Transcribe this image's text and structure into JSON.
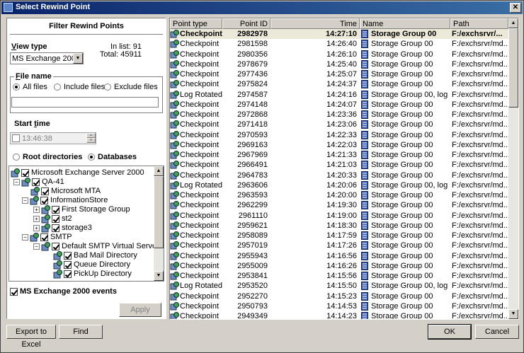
{
  "window": {
    "title": "Select Rewind Point",
    "close_glyph": "✕"
  },
  "filter": {
    "title": "Filter Rewind Points",
    "view_type_label": "View type",
    "view_type_value": "MS Exchange 2000",
    "in_list": "In list: 91",
    "total": "Total: 45911",
    "file_name_label": "File name",
    "radio_all": "All files",
    "radio_include": "Include files",
    "radio_exclude": "Exclude files",
    "file_name_value": "",
    "start_time_label": "Start time",
    "start_time_value": "13:46:38",
    "radio_root": "Root directories",
    "radio_databases": "Databases",
    "tree": [
      "Microsoft Exchange Server 2000",
      "QA-41",
      "Microsoft MTA",
      "InformationStore",
      "First Storage Group",
      "st2",
      "storage3",
      "SMTP",
      "Default SMTP Virtual Server",
      "Bad Mail Directory",
      "Queue Directory",
      "PickUp Directory"
    ],
    "events_label": "MS Exchange 2000 events",
    "apply_label": "Apply"
  },
  "table": {
    "columns": [
      "Point type",
      "Point ID",
      "Time",
      "Name",
      "Path"
    ],
    "rows": [
      [
        "Checkpoint",
        "2982978",
        "14:27:10",
        "Storage Group 00",
        "F:/exchsrvr/..."
      ],
      [
        "Checkpoint",
        "2981598",
        "14:26:40",
        "Storage Group 00",
        "F:/exchsrvr/md..."
      ],
      [
        "Checkpoint",
        "2980356",
        "14:26:10",
        "Storage Group 00",
        "F:/exchsrvr/md..."
      ],
      [
        "Checkpoint",
        "2978679",
        "14:25:40",
        "Storage Group 00",
        "F:/exchsrvr/md..."
      ],
      [
        "Checkpoint",
        "2977436",
        "14:25:07",
        "Storage Group 00",
        "F:/exchsrvr/md..."
      ],
      [
        "Checkpoint",
        "2975824",
        "14:24:37",
        "Storage Group 00",
        "F:/exchsrvr/md..."
      ],
      [
        "Log Rotated",
        "2974587",
        "14:24:16",
        "Storage Group 00, log ...",
        "F:/exchsrvr/md..."
      ],
      [
        "Checkpoint",
        "2974148",
        "14:24:07",
        "Storage Group 00",
        "F:/exchsrvr/md..."
      ],
      [
        "Checkpoint",
        "2972868",
        "14:23:36",
        "Storage Group 00",
        "F:/exchsrvr/md..."
      ],
      [
        "Checkpoint",
        "2971418",
        "14:23:06",
        "Storage Group 00",
        "F:/exchsrvr/md..."
      ],
      [
        "Checkpoint",
        "2970593",
        "14:22:33",
        "Storage Group 00",
        "F:/exchsrvr/md..."
      ],
      [
        "Checkpoint",
        "2969163",
        "14:22:03",
        "Storage Group 00",
        "F:/exchsrvr/md..."
      ],
      [
        "Checkpoint",
        "2967969",
        "14:21:33",
        "Storage Group 00",
        "F:/exchsrvr/md..."
      ],
      [
        "Checkpoint",
        "2966491",
        "14:21:03",
        "Storage Group 00",
        "F:/exchsrvr/md..."
      ],
      [
        "Checkpoint",
        "2964783",
        "14:20:33",
        "Storage Group 00",
        "F:/exchsrvr/md..."
      ],
      [
        "Log Rotated",
        "2963606",
        "14:20:06",
        "Storage Group 00, log ...",
        "F:/exchsrvr/md..."
      ],
      [
        "Checkpoint",
        "2963593",
        "14:20:00",
        "Storage Group 00",
        "F:/exchsrvr/md..."
      ],
      [
        "Checkpoint",
        "2962299",
        "14:19:30",
        "Storage Group 00",
        "F:/exchsrvr/md..."
      ],
      [
        "Checkpoint",
        "2961110",
        "14:19:00",
        "Storage Group 00",
        "F:/exchsrvr/md..."
      ],
      [
        "Checkpoint",
        "2959621",
        "14:18:30",
        "Storage Group 00",
        "F:/exchsrvr/md..."
      ],
      [
        "Checkpoint",
        "2958089",
        "14:17:59",
        "Storage Group 00",
        "F:/exchsrvr/md..."
      ],
      [
        "Checkpoint",
        "2957019",
        "14:17:26",
        "Storage Group 00",
        "F:/exchsrvr/md..."
      ],
      [
        "Checkpoint",
        "2955943",
        "14:16:56",
        "Storage Group 00",
        "F:/exchsrvr/md..."
      ],
      [
        "Checkpoint",
        "2955009",
        "14:16:26",
        "Storage Group 00",
        "F:/exchsrvr/md..."
      ],
      [
        "Checkpoint",
        "2953841",
        "14:15:56",
        "Storage Group 00",
        "F:/exchsrvr/md..."
      ],
      [
        "Log Rotated",
        "2953520",
        "14:15:50",
        "Storage Group 00, log ...",
        "F:/exchsrvr/md..."
      ],
      [
        "Checkpoint",
        "2952270",
        "14:15:23",
        "Storage Group 00",
        "F:/exchsrvr/md..."
      ],
      [
        "Checkpoint",
        "2950793",
        "14:14:53",
        "Storage Group 00",
        "F:/exchsrvr/md..."
      ],
      [
        "Checkpoint",
        "2949349",
        "14:14:23",
        "Storage Group 00",
        "F:/exchsrvr/md..."
      ]
    ]
  },
  "buttons": {
    "export": "Export to Excel",
    "find": "Find",
    "ok": "OK",
    "cancel": "Cancel"
  },
  "icons": {
    "title": "rewind-app-icon",
    "point": "globe-server-icon",
    "name": "document-icon",
    "tree_node": "globe-server-icon"
  },
  "colors": {
    "titlebar_start": "#0a246a",
    "titlebar_end": "#3a6ea5",
    "face": "#d4d0c8"
  }
}
